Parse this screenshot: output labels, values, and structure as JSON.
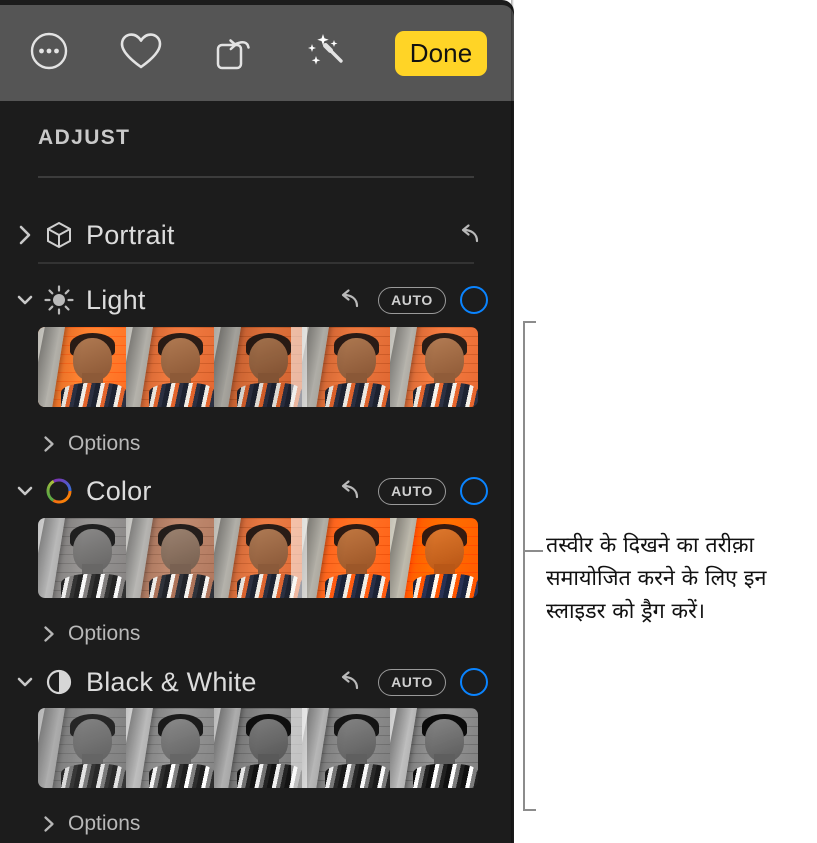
{
  "app": {
    "panel_title": "ADJUST",
    "background_color": "#1c1c1c",
    "toolbar_color": "#555555",
    "accent_blue": "#0a84ff",
    "done_color": "#ffd426"
  },
  "toolbar": {
    "buttons": [
      {
        "name": "more-options",
        "icon": "ellipsis-circle-icon",
        "label": ""
      },
      {
        "name": "favorite",
        "icon": "heart-icon",
        "label": ""
      },
      {
        "name": "rotate",
        "icon": "rotate-square-icon",
        "label": ""
      },
      {
        "name": "auto-enhance",
        "icon": "magic-wand-icon",
        "label": ""
      }
    ],
    "done_label": "Done"
  },
  "adjust": {
    "header": "ADJUST",
    "sections": [
      {
        "id": "portrait",
        "label": "Portrait",
        "icon": "cube-icon",
        "expanded": false,
        "chevron": "chevron-right",
        "has_reset": true,
        "has_auto": false,
        "has_toggle": false,
        "auto_label": "",
        "options_label": "",
        "has_filmstrip": false
      },
      {
        "id": "light",
        "label": "Light",
        "icon": "sun-icon",
        "expanded": true,
        "chevron": "chevron-down",
        "has_reset": true,
        "has_auto": true,
        "has_toggle": true,
        "auto_label": "AUTO",
        "options_label": "Options",
        "has_filmstrip": true,
        "filmstrip_style": "exposure"
      },
      {
        "id": "color",
        "label": "Color",
        "icon": "color-wheel-icon",
        "expanded": true,
        "chevron": "chevron-down",
        "has_reset": true,
        "has_auto": true,
        "has_toggle": true,
        "auto_label": "AUTO",
        "options_label": "Options",
        "has_filmstrip": true,
        "filmstrip_style": "saturation"
      },
      {
        "id": "black-and-white",
        "label": "Black & White",
        "icon": "half-circle-contrast-icon",
        "expanded": true,
        "chevron": "chevron-down",
        "has_reset": true,
        "has_auto": true,
        "has_toggle": true,
        "auto_label": "AUTO",
        "options_label": "Options",
        "has_filmstrip": true,
        "filmstrip_style": "monochrome"
      }
    ]
  },
  "callout": {
    "text": "तस्वीर के दिखने का तरीक़ा समायोजित करने के लिए इन स्लाइडर को ड्रैग करें।",
    "line_color": "#8c8c8c"
  }
}
